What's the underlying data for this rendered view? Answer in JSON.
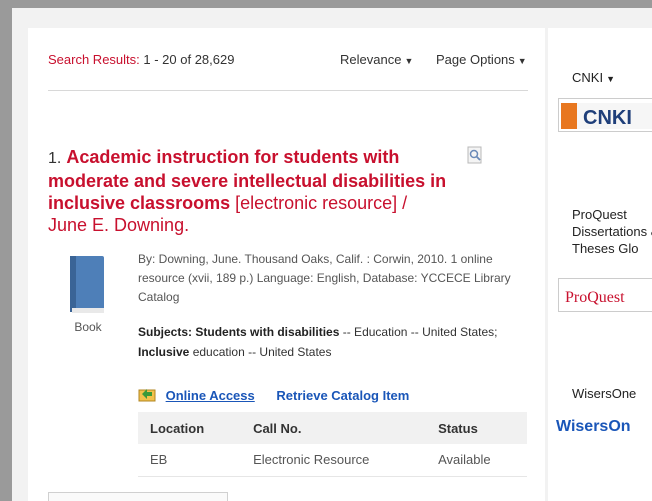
{
  "toolbar": {
    "results_label": "Search Results:",
    "results_range": "1 - 20 of 28,629",
    "sort_label": "Relevance",
    "page_options_label": "Page Options"
  },
  "record": {
    "number": "1.",
    "title_main": "Academic instruction for students with moderate and severe intellectual disabilities in inclusive classrooms",
    "title_sub": "[electronic resource] / June E. Downing.",
    "format": "Book",
    "meta": "By: Downing, June. Thousand Oaks, Calif. : Corwin, 2010. 1 online resource (xvii, 189 p.) Language: English, Database: YCCECE Library Catalog",
    "subjects_label": "Subjects:",
    "subject1_bold": "Students with disabilities",
    "subject1_rest": "-- Education -- United States;",
    "subject2_bold": "Inclusive",
    "subject2_rest": "education -- United States",
    "online_access": "Online Access",
    "retrieve": "Retrieve Catalog Item",
    "holdings": {
      "headers": [
        "Location",
        "Call No.",
        "Status"
      ],
      "rows": [
        [
          "EB",
          "Electronic Resource",
          "Available"
        ]
      ]
    }
  },
  "sidebar": {
    "cnki_label": "CNKI",
    "cnki_logo_text": "CNKI",
    "proquest_label": "ProQuest Dissertations & Theses Glo",
    "proquest_logo_text": "ProQuest",
    "wisers_label": "WisersOne",
    "wisers_logo_text": "WisersOn"
  },
  "colors": {
    "accent": "#c8102e",
    "link": "#1a56b8"
  }
}
